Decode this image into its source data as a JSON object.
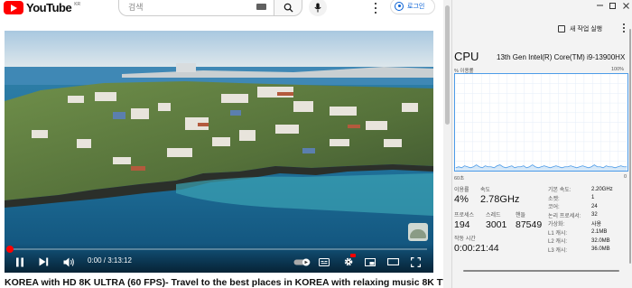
{
  "youtube": {
    "logo_text": "YouTube",
    "region_code": "KR",
    "search_placeholder": "검색",
    "login_label": "로그인",
    "player": {
      "time": "0:00 / 3:13:12",
      "progress_fraction": 0.001
    },
    "video_title": "KOREA with HD 8K ULTRA (60 FPS)- Travel to the best places in KOREA with relaxing music 8K TV"
  },
  "task_manager": {
    "new_task_label": "새 작업 실행",
    "heading": "CPU",
    "cpu_model": "13th Gen Intel(R) Core(TM) i9-13900HX",
    "usage_label": "% 이용률",
    "usage_max": "100%",
    "graph_time_label": "60초",
    "graph_zero_label": "0",
    "usage_history_percent": [
      3,
      4,
      3,
      5,
      4,
      3,
      4,
      6,
      4,
      3,
      5,
      4,
      4,
      3,
      5,
      6,
      4,
      3,
      4,
      5,
      3,
      4,
      4,
      5,
      3,
      4,
      6,
      4,
      3,
      4,
      5,
      4,
      3,
      4,
      5,
      4,
      3,
      4,
      4,
      5,
      4,
      3,
      4,
      5,
      4,
      3,
      4,
      6,
      4,
      4,
      3,
      5,
      4,
      4,
      3,
      4,
      5,
      4,
      4
    ],
    "stats": {
      "utilization": {
        "label": "이용률",
        "value": "4%"
      },
      "speed": {
        "label": "속도",
        "value": "2.78GHz"
      },
      "processes": {
        "label": "프로세스",
        "value": "194"
      },
      "threads": {
        "label": "스레드",
        "value": "3001"
      },
      "handles": {
        "label": "핸들",
        "value": "87549"
      },
      "uptime": {
        "label": "작동 시간",
        "value": "0:00:21:44"
      }
    },
    "details": [
      {
        "k": "기본 속도:",
        "v": "2.20GHz"
      },
      {
        "k": "소켓:",
        "v": "1"
      },
      {
        "k": "코어:",
        "v": "24"
      },
      {
        "k": "논리 프로세서:",
        "v": "32"
      },
      {
        "k": "가상화:",
        "v": "사용"
      },
      {
        "k": "L1 캐시:",
        "v": "2.1MB"
      },
      {
        "k": "L2 캐시:",
        "v": "32.0MB"
      },
      {
        "k": "L3 캐시:",
        "v": "36.0MB"
      }
    ]
  },
  "colors": {
    "youtube_red": "#ff0000",
    "link_blue": "#065fd4",
    "cpu_graph_line": "#4c9be8"
  }
}
